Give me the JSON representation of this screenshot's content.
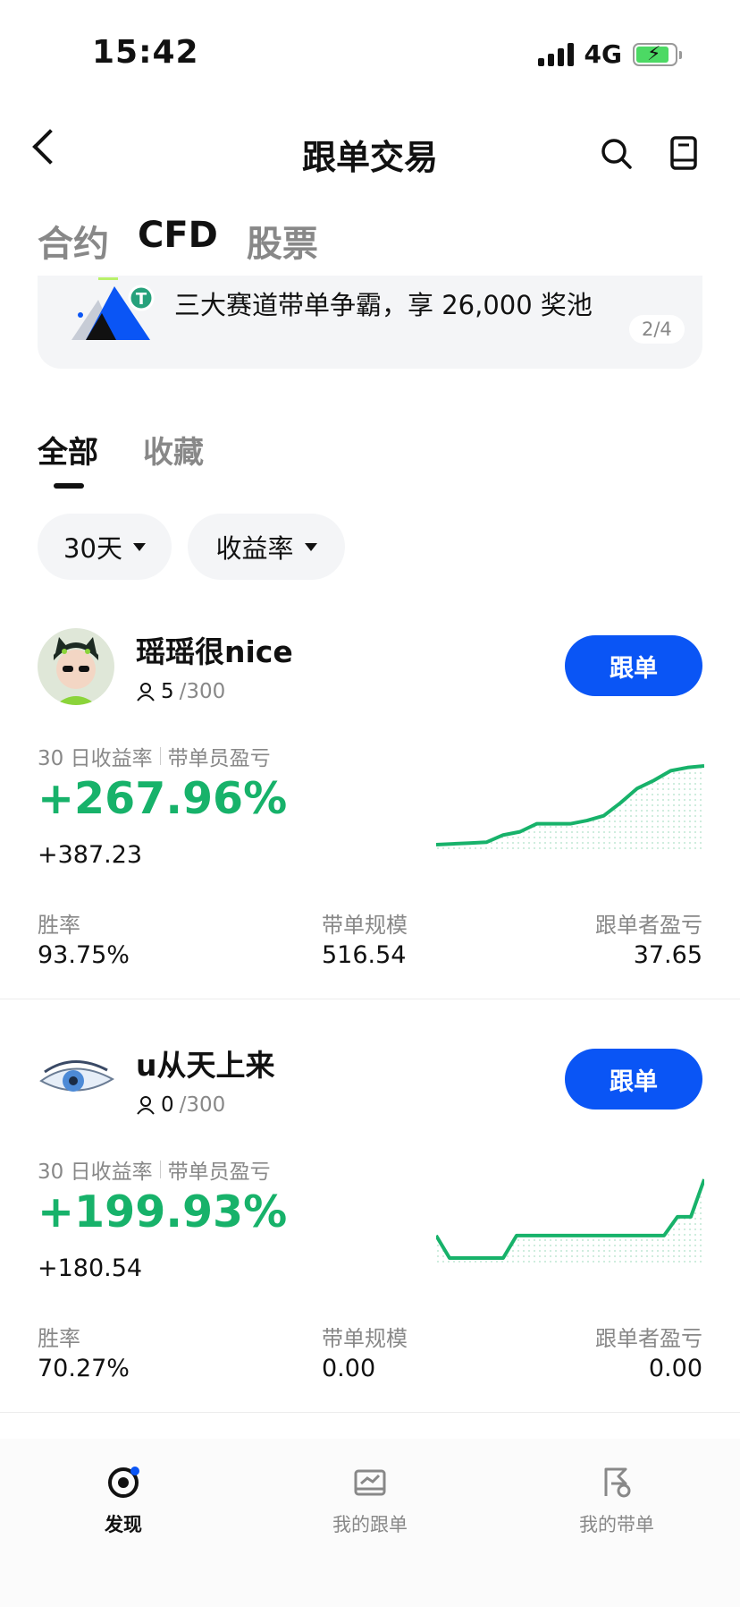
{
  "status": {
    "time": "15:42",
    "network": "4G"
  },
  "header": {
    "title": "跟单交易"
  },
  "category_tabs": [
    {
      "label": "合约",
      "active": false
    },
    {
      "label": "CFD",
      "active": true
    },
    {
      "label": "股票",
      "active": false
    }
  ],
  "banner": {
    "text": "三大赛道带单争霸，享 26,000 奖池",
    "pager": "2/4"
  },
  "sub_tabs": [
    {
      "label": "全部",
      "active": true
    },
    {
      "label": "收藏",
      "active": false
    }
  ],
  "filters": {
    "period": "30天",
    "sort": "收益率"
  },
  "traders": [
    {
      "name": "瑶瑶很nice",
      "followers": "5",
      "capacity": "/300",
      "follow_label": "跟单",
      "roi_label": "30 日收益率",
      "pnl_label": "带单员盈亏",
      "roi": "+267.96%",
      "pnl": "+387.23",
      "win_rate_label": "胜率",
      "win_rate": "93.75%",
      "aum_label": "带单规模",
      "aum": "516.54",
      "follower_pnl_label": "跟单者盈亏",
      "follower_pnl": "37.65",
      "trend": [
        0,
        0.5,
        1,
        1.5,
        6,
        8,
        13,
        13,
        13,
        15,
        18,
        26,
        35,
        40,
        46,
        48,
        49
      ]
    },
    {
      "name": "u从天上来",
      "followers": "0",
      "capacity": "/300",
      "follow_label": "跟单",
      "roi_label": "30 日收益率",
      "pnl_label": "带单员盈亏",
      "roi": "+199.93%",
      "pnl": "+180.54",
      "win_rate_label": "胜率",
      "win_rate": "70.27%",
      "aum_label": "带单规模",
      "aum": "0.00",
      "follower_pnl_label": "跟单者盈亏",
      "follower_pnl": "0.00",
      "trend": [
        12,
        0,
        0,
        0,
        0,
        0,
        12,
        12,
        12,
        12,
        12,
        12,
        12,
        12,
        12,
        12,
        12,
        12,
        22,
        22,
        42
      ]
    }
  ],
  "bottom_nav": [
    {
      "label": "发现",
      "icon": "discover-icon",
      "active": true
    },
    {
      "label": "我的跟单",
      "icon": "chart-box-icon",
      "active": false
    },
    {
      "label": "我的带单",
      "icon": "flag-icon",
      "active": false
    }
  ],
  "colors": {
    "accent": "#0a55f5",
    "positive": "#17b26a"
  }
}
